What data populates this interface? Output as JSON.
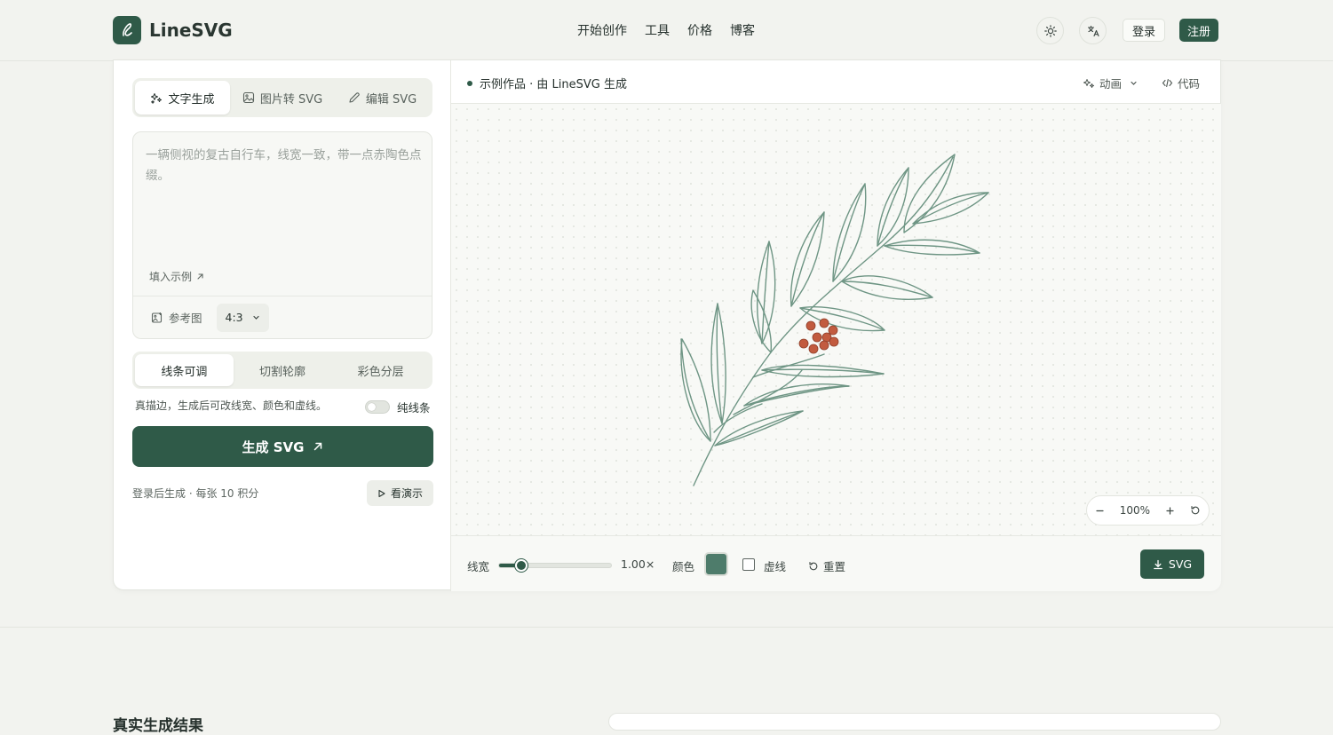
{
  "brand": {
    "name": "LineSVG"
  },
  "nav": [
    "开始创作",
    "工具",
    "价格",
    "博客"
  ],
  "header": {
    "login": "登录",
    "signup": "注册"
  },
  "modes": [
    "文字生成",
    "图片转 SVG",
    "编辑 SVG"
  ],
  "prompt": {
    "placeholder": "一辆侧视的复古自行车，线宽一致，带一点赤陶色点缀。",
    "fill_example": "填入示例",
    "reference": "参考图",
    "ratio": "4:3"
  },
  "styles": [
    "线条可调",
    "切割轮廓",
    "彩色分层"
  ],
  "style_desc": "真描边，生成后可改线宽、颜色和虚线。",
  "pure_line": "纯线条",
  "generate": "生成 SVG",
  "credit": "登录后生成 · 每张 10 积分",
  "demo": "看演示",
  "preview": {
    "title": "示例作品 · 由 LineSVG 生成",
    "animation": "动画",
    "code": "代码",
    "zoom": "100%"
  },
  "controls": {
    "width_label": "线宽",
    "width_value": "1.00×",
    "width_fraction": 0.2,
    "color_label": "颜色",
    "stroke_color": "#4e7c6b",
    "accent_color": "#c25b3f",
    "dashed": "虚线",
    "reset": "重置",
    "download": "SVG"
  },
  "section": {
    "title": "真实生成结果"
  }
}
